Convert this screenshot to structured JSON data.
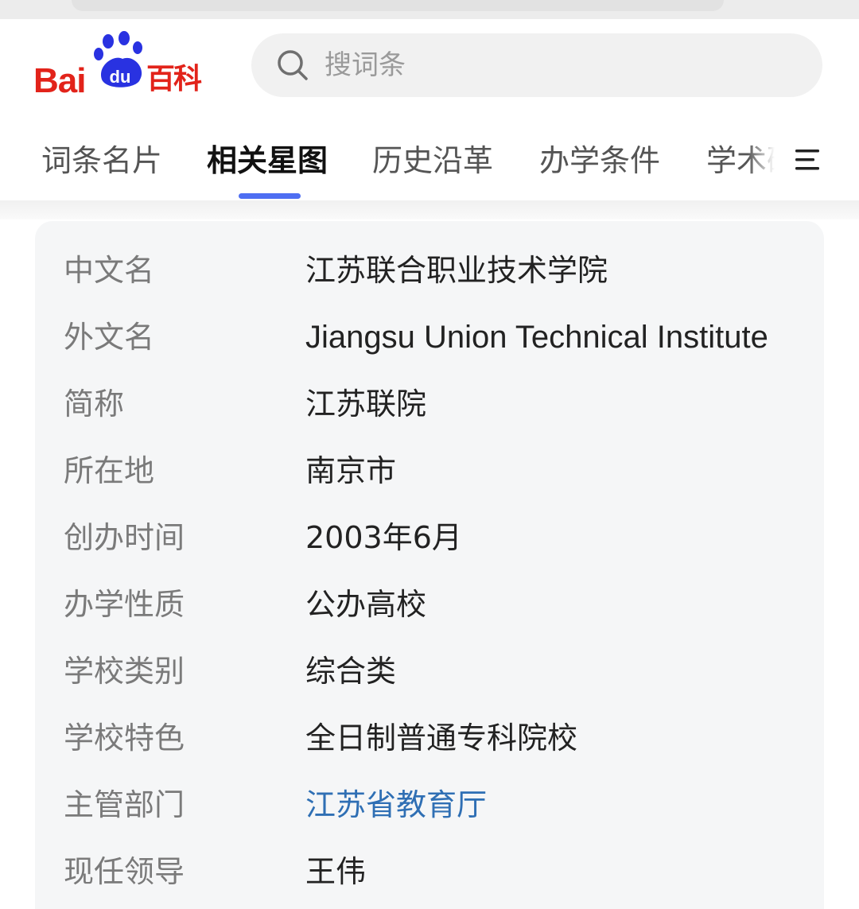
{
  "header": {
    "logo": {
      "latin": "Bai",
      "paw_text": "du",
      "cn": "百科"
    },
    "search": {
      "placeholder": "搜词条",
      "icon": "search-icon"
    }
  },
  "tabs": [
    {
      "label": "词条名片",
      "active": false
    },
    {
      "label": "相关星图",
      "active": true
    },
    {
      "label": "历史沿革",
      "active": false
    },
    {
      "label": "办学条件",
      "active": false
    },
    {
      "label": "学术研",
      "active": false
    }
  ],
  "menu_icon": "menu-icon",
  "info": {
    "rows": [
      {
        "label": "中文名",
        "value": "江苏联合职业技术学院"
      },
      {
        "label": "外文名",
        "value": "Jiangsu Union Technical Institute"
      },
      {
        "label": "简称",
        "value": "江苏联院"
      },
      {
        "label": "所在地",
        "value": "南京市"
      },
      {
        "label": "创办时间",
        "value": "2003年6月"
      },
      {
        "label": "办学性质",
        "value": "公办高校"
      },
      {
        "label": "学校类别",
        "value": "综合类"
      },
      {
        "label": "学校特色",
        "value": "全日制普通专科院校"
      },
      {
        "label": "主管部门",
        "value": "江苏省教育厅",
        "link": true
      },
      {
        "label": "现任领导",
        "value": "王伟"
      }
    ]
  },
  "colors": {
    "brand_red": "#e2231a",
    "brand_blue": "#2932e1",
    "tab_indicator": "#4e6ef2",
    "link": "#2f6fb4",
    "card_bg": "#f5f6f7"
  }
}
